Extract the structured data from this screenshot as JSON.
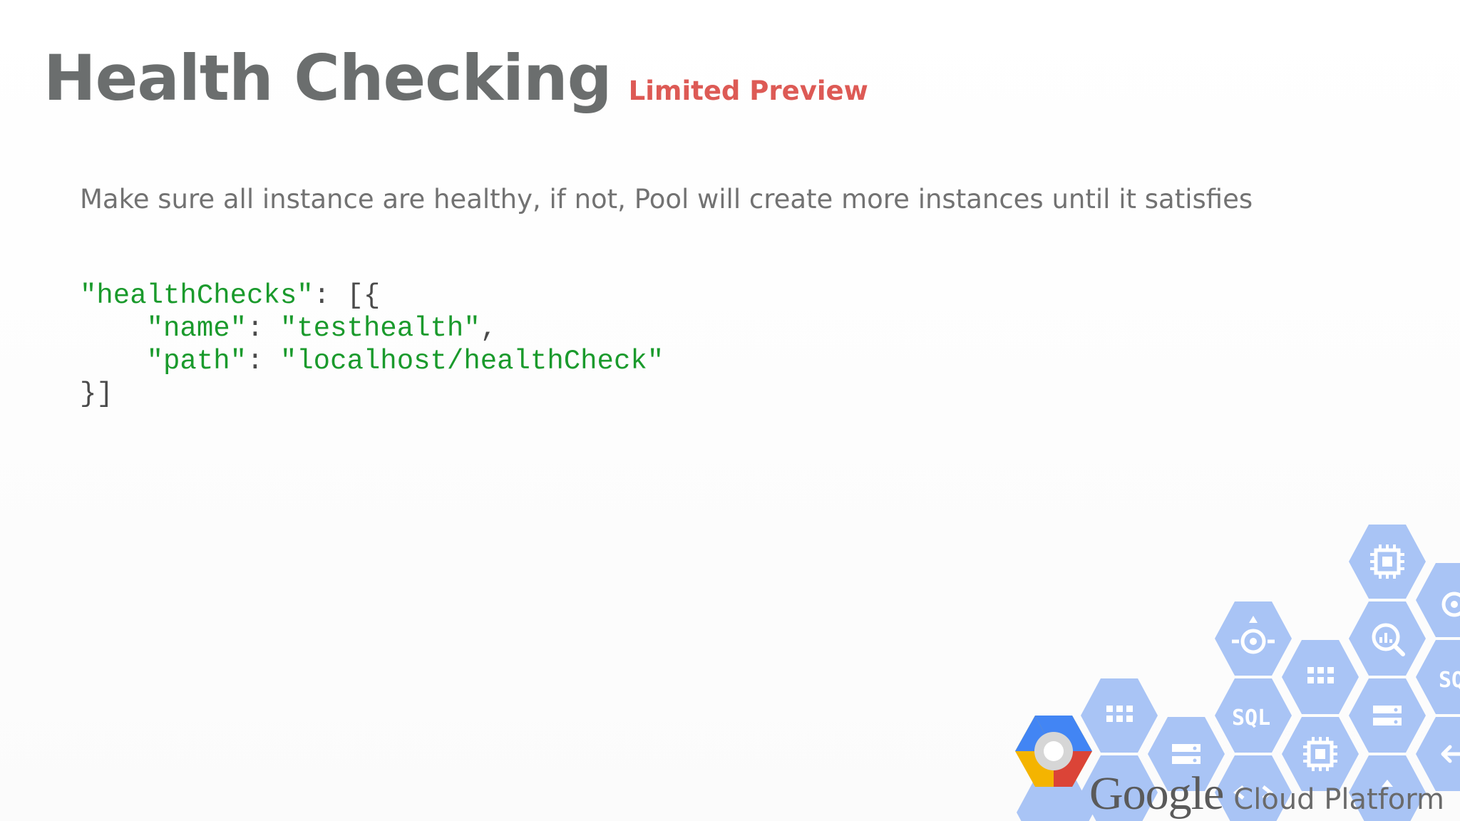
{
  "slide": {
    "title": "Health Checking",
    "subtitle": "Limited Preview",
    "description": "Make sure all instance are healthy, if not, Pool will create more instances until it satisfies"
  },
  "code": {
    "line1_key": "\"healthChecks\"",
    "line1_rest": ": [{",
    "line2_indent": "    ",
    "line2_key": "\"name\"",
    "line2_sep": ": ",
    "line2_val": "\"testhealth\"",
    "line2_end": ",",
    "line3_indent": "    ",
    "line3_key": "\"path\"",
    "line3_sep": ": ",
    "line3_val": "\"localhost/healthCheck\"",
    "line4": "}]"
  },
  "branding": {
    "google": "Google",
    "cloud_platform": "Cloud Platform",
    "hex_labels": {
      "sql": "SQL",
      "sql_partial": "SQ"
    }
  },
  "colors": {
    "title": "#6b6e6e",
    "subtitle": "#dd5a55",
    "string": "#1a9a2c",
    "hex_fill": "#a9c4f5",
    "hex_icon": "#ffffff"
  }
}
